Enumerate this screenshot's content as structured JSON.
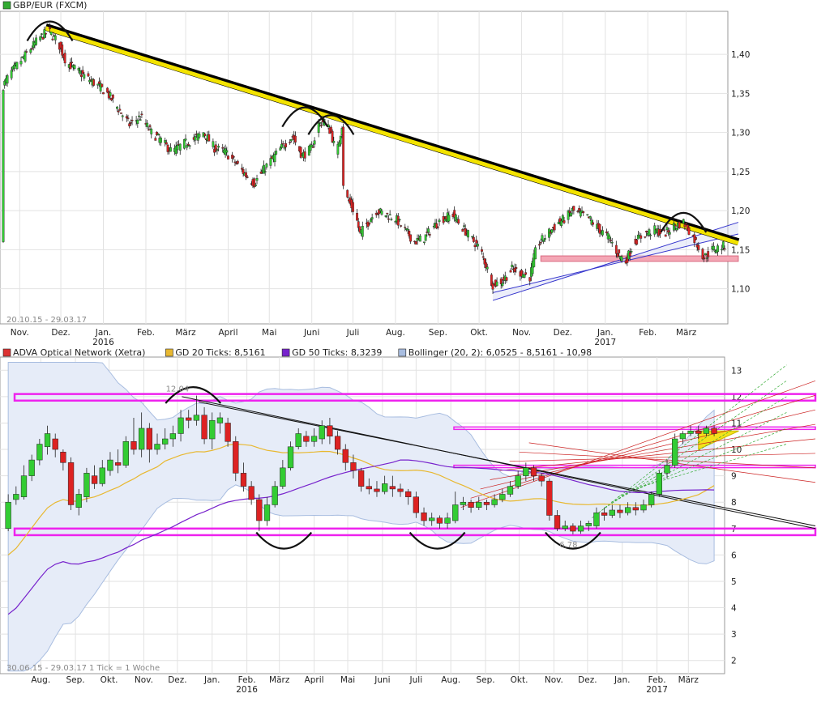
{
  "chart_data": [
    {
      "type": "candlestick",
      "legend": [
        {
          "name": "GBP/EUR (FXCM)",
          "color": "#33aa33"
        }
      ],
      "date_range_label": "20.10.15 - 29.03.17",
      "y_ticks": [
        1.1,
        1.15,
        1.2,
        1.25,
        1.3,
        1.35,
        1.4
      ],
      "y_tick_labels": [
        "1,10",
        "1,15",
        "1,20",
        "1,25",
        "1,30",
        "1,35",
        "1,40"
      ],
      "ylim": [
        1.055,
        1.455
      ],
      "x_range": [
        "2015-10-20",
        "2017-03-29"
      ],
      "x_ticks": [
        {
          "label": "Nov.",
          "date": "2015-11-01"
        },
        {
          "label": "Dez.",
          "date": "2015-12-01"
        },
        {
          "label": "Jan.",
          "date": "2016-01-01",
          "year": "2016"
        },
        {
          "label": "Feb.",
          "date": "2016-02-01"
        },
        {
          "label": "März",
          "date": "2016-03-01"
        },
        {
          "label": "April",
          "date": "2016-04-01"
        },
        {
          "label": "Mai",
          "date": "2016-05-01"
        },
        {
          "label": "Juni",
          "date": "2016-06-01"
        },
        {
          "label": "Juli",
          "date": "2016-07-01"
        },
        {
          "label": "Aug.",
          "date": "2016-08-01"
        },
        {
          "label": "Sep.",
          "date": "2016-09-01"
        },
        {
          "label": "Okt.",
          "date": "2016-10-01"
        },
        {
          "label": "Nov.",
          "date": "2016-11-01"
        },
        {
          "label": "Dez.",
          "date": "2016-12-01"
        },
        {
          "label": "Jan.",
          "date": "2017-01-01",
          "year": "2017"
        },
        {
          "label": "Feb.",
          "date": "2017-02-01"
        },
        {
          "label": "März",
          "date": "2017-03-01"
        }
      ],
      "price_path": [
        [
          "2015-10-20",
          1.36
        ],
        [
          "2015-10-25",
          1.375
        ],
        [
          "2015-11-01",
          1.39
        ],
        [
          "2015-11-08",
          1.405
        ],
        [
          "2015-11-15",
          1.42
        ],
        [
          "2015-11-22",
          1.43
        ],
        [
          "2015-11-29",
          1.415
        ],
        [
          "2015-12-05",
          1.39
        ],
        [
          "2015-12-12",
          1.38
        ],
        [
          "2015-12-20",
          1.37
        ],
        [
          "2015-12-28",
          1.36
        ],
        [
          "2016-01-04",
          1.35
        ],
        [
          "2016-01-12",
          1.33
        ],
        [
          "2016-01-20",
          1.31
        ],
        [
          "2016-01-28",
          1.32
        ],
        [
          "2016-02-05",
          1.3
        ],
        [
          "2016-02-12",
          1.29
        ],
        [
          "2016-02-20",
          1.275
        ],
        [
          "2016-02-28",
          1.285
        ],
        [
          "2016-03-06",
          1.29
        ],
        [
          "2016-03-14",
          1.3
        ],
        [
          "2016-03-22",
          1.28
        ],
        [
          "2016-03-30",
          1.275
        ],
        [
          "2016-04-07",
          1.26
        ],
        [
          "2016-04-14",
          1.245
        ],
        [
          "2016-04-20",
          1.235
        ],
        [
          "2016-04-28",
          1.255
        ],
        [
          "2016-05-05",
          1.27
        ],
        [
          "2016-05-12",
          1.285
        ],
        [
          "2016-05-18",
          1.295
        ],
        [
          "2016-05-25",
          1.27
        ],
        [
          "2016-06-01",
          1.28
        ],
        [
          "2016-06-06",
          1.31
        ],
        [
          "2016-06-10",
          1.315
        ],
        [
          "2016-06-15",
          1.3
        ],
        [
          "2016-06-19",
          1.27
        ],
        [
          "2016-06-23",
          1.31
        ],
        [
          "2016-06-24",
          1.235
        ],
        [
          "2016-06-27",
          1.215
        ],
        [
          "2016-07-03",
          1.195
        ],
        [
          "2016-07-06",
          1.17
        ],
        [
          "2016-07-12",
          1.185
        ],
        [
          "2016-07-18",
          1.2
        ],
        [
          "2016-07-25",
          1.195
        ],
        [
          "2016-08-01",
          1.19
        ],
        [
          "2016-08-08",
          1.175
        ],
        [
          "2016-08-15",
          1.16
        ],
        [
          "2016-08-22",
          1.165
        ],
        [
          "2016-08-29",
          1.18
        ],
        [
          "2016-09-05",
          1.19
        ],
        [
          "2016-09-12",
          1.195
        ],
        [
          "2016-09-18",
          1.18
        ],
        [
          "2016-09-25",
          1.165
        ],
        [
          "2016-10-02",
          1.15
        ],
        [
          "2016-10-07",
          1.125
        ],
        [
          "2016-10-11",
          1.105
        ],
        [
          "2016-10-18",
          1.11
        ],
        [
          "2016-10-25",
          1.125
        ],
        [
          "2016-11-01",
          1.12
        ],
        [
          "2016-11-07",
          1.115
        ],
        [
          "2016-11-12",
          1.155
        ],
        [
          "2016-11-20",
          1.17
        ],
        [
          "2016-11-28",
          1.185
        ],
        [
          "2016-12-03",
          1.19
        ],
        [
          "2016-12-08",
          1.2
        ],
        [
          "2016-12-15",
          1.195
        ],
        [
          "2016-12-20",
          1.19
        ],
        [
          "2016-12-28",
          1.175
        ],
        [
          "2017-01-04",
          1.165
        ],
        [
          "2017-01-10",
          1.145
        ],
        [
          "2017-01-16",
          1.135
        ],
        [
          "2017-01-22",
          1.16
        ],
        [
          "2017-01-30",
          1.17
        ],
        [
          "2017-02-06",
          1.175
        ],
        [
          "2017-02-13",
          1.17
        ],
        [
          "2017-02-20",
          1.18
        ],
        [
          "2017-02-27",
          1.185
        ],
        [
          "2017-03-03",
          1.175
        ],
        [
          "2017-03-08",
          1.16
        ],
        [
          "2017-03-14",
          1.14
        ],
        [
          "2017-03-20",
          1.15
        ],
        [
          "2017-03-29",
          1.155
        ]
      ],
      "trendlines": [
        {
          "kind": "resistance",
          "from": [
            "2015-11-20",
            1.435
          ],
          "to": [
            "2017-04-08",
            1.16
          ],
          "color": "#f3e300"
        },
        {
          "kind": "channel",
          "from": [
            "2016-10-11",
            1.085
          ],
          "to": [
            "2017-04-08",
            1.185
          ],
          "color": "#3333cc"
        },
        {
          "kind": "channel",
          "from": [
            "2016-10-11",
            1.095
          ],
          "to": [
            "2017-04-08",
            1.17
          ],
          "color": "#3333cc"
        }
      ],
      "support_zone": {
        "from_date": "2016-11-15",
        "to_date": "2017-04-08",
        "low": 1.135,
        "high": 1.142,
        "color": "#f4a7b5"
      },
      "pattern_arcs": [
        {
          "date": "2015-11-23",
          "value": 1.44
        },
        {
          "date": "2016-05-27",
          "value": 1.33
        },
        {
          "date": "2016-06-15",
          "value": 1.32
        },
        {
          "date": "2017-02-27",
          "value": 1.195
        }
      ]
    },
    {
      "type": "candlestick",
      "legend": [
        {
          "name": "ADVA Optical Network (Xetra)",
          "color": "#dd3333"
        },
        {
          "name": "GD 20 Ticks: 8,5161",
          "color": "#e8b830"
        },
        {
          "name": "GD 50 Ticks: 8,3239",
          "color": "#7722cc"
        },
        {
          "name": "Bollinger (20, 2): 6,0525 - 8,5161 - 10,98",
          "color": "#a8bde0"
        }
      ],
      "date_range_label": "30.06.15 - 29.03.17",
      "tick_note": "1 Tick = 1 Woche",
      "y_ticks": [
        2,
        3,
        4,
        5,
        6,
        7,
        8,
        9,
        10,
        11,
        12,
        13
      ],
      "y_tick_labels": [
        "2",
        "3",
        "4",
        "5",
        "6",
        "7",
        "8",
        "9",
        "10",
        "11",
        "12",
        "13"
      ],
      "ylim": [
        1.5,
        13.5
      ],
      "x_range": [
        "2015-06-30",
        "2017-03-29"
      ],
      "x_ticks": [
        {
          "label": "Aug.",
          "date": "2015-08-01"
        },
        {
          "label": "Sep.",
          "date": "2015-09-01"
        },
        {
          "label": "Okt.",
          "date": "2015-10-01"
        },
        {
          "label": "Nov.",
          "date": "2015-11-01"
        },
        {
          "label": "Dez.",
          "date": "2015-12-01"
        },
        {
          "label": "Jan.",
          "date": "2016-01-01"
        },
        {
          "label": "Feb.",
          "date": "2016-02-01",
          "year": "2016"
        },
        {
          "label": "März",
          "date": "2016-03-01"
        },
        {
          "label": "April",
          "date": "2016-04-01"
        },
        {
          "label": "Mai",
          "date": "2016-05-01"
        },
        {
          "label": "Juni",
          "date": "2016-06-01"
        },
        {
          "label": "Juli",
          "date": "2016-07-01"
        },
        {
          "label": "Aug.",
          "date": "2016-08-01"
        },
        {
          "label": "Sep.",
          "date": "2016-09-01"
        },
        {
          "label": "Okt.",
          "date": "2016-10-01"
        },
        {
          "label": "Nov.",
          "date": "2016-11-01"
        },
        {
          "label": "Dez.",
          "date": "2016-12-01"
        },
        {
          "label": "Jan.",
          "date": "2017-01-01"
        },
        {
          "label": "Feb.",
          "date": "2017-02-01",
          "year": "2017"
        },
        {
          "label": "März",
          "date": "2017-03-01"
        }
      ],
      "candles": [
        [
          7.0,
          8.0,
          6.9,
          8.3
        ],
        [
          8.1,
          8.3,
          7.9,
          8.6
        ],
        [
          8.2,
          9.0,
          8.1,
          9.4
        ],
        [
          9.0,
          9.6,
          8.8,
          9.8
        ],
        [
          9.6,
          10.2,
          9.4,
          10.4
        ],
        [
          10.1,
          10.6,
          9.8,
          10.9
        ],
        [
          10.4,
          10.0,
          9.7,
          10.6
        ],
        [
          9.9,
          9.5,
          9.2,
          10.0
        ],
        [
          9.5,
          7.9,
          7.7,
          9.7
        ],
        [
          7.8,
          8.3,
          7.5,
          8.5
        ],
        [
          8.2,
          9.1,
          8.0,
          9.3
        ],
        [
          9.0,
          8.7,
          8.5,
          9.4
        ],
        [
          8.7,
          9.3,
          8.6,
          9.6
        ],
        [
          9.2,
          9.6,
          9.0,
          9.9
        ],
        [
          9.5,
          9.4,
          9.1,
          10.0
        ],
        [
          9.4,
          10.3,
          9.3,
          10.5
        ],
        [
          10.3,
          10.0,
          9.8,
          11.2
        ],
        [
          10.0,
          10.8,
          9.7,
          11.4
        ],
        [
          10.8,
          10.0,
          9.5,
          11.0
        ],
        [
          10.0,
          10.2,
          9.8,
          10.6
        ],
        [
          10.2,
          10.4,
          10.0,
          10.8
        ],
        [
          10.4,
          10.6,
          10.1,
          10.9
        ],
        [
          10.6,
          11.2,
          10.3,
          11.5
        ],
        [
          11.2,
          11.1,
          10.8,
          11.5
        ],
        [
          11.1,
          11.3,
          10.9,
          12.04
        ],
        [
          11.3,
          10.4,
          10.2,
          11.6
        ],
        [
          10.4,
          11.1,
          10.0,
          11.4
        ],
        [
          11.0,
          11.2,
          10.6,
          11.4
        ],
        [
          11.0,
          10.3,
          10.1,
          11.2
        ],
        [
          10.3,
          9.1,
          8.8,
          10.5
        ],
        [
          9.1,
          8.6,
          8.4,
          9.5
        ],
        [
          8.6,
          8.1,
          7.9,
          8.8
        ],
        [
          8.1,
          7.3,
          6.9,
          8.3
        ],
        [
          7.3,
          7.9,
          7.1,
          8.2
        ],
        [
          7.9,
          8.6,
          7.8,
          8.8
        ],
        [
          8.6,
          9.3,
          8.5,
          9.6
        ],
        [
          9.3,
          10.1,
          9.2,
          10.3
        ],
        [
          10.1,
          10.6,
          10.0,
          10.8
        ],
        [
          10.5,
          10.3,
          10.1,
          10.7
        ],
        [
          10.3,
          10.5,
          10.1,
          10.8
        ],
        [
          10.4,
          10.9,
          10.2,
          11.1
        ],
        [
          10.9,
          10.5,
          10.2,
          11.2
        ],
        [
          10.5,
          10.0,
          9.8,
          10.7
        ],
        [
          10.0,
          9.5,
          9.2,
          10.2
        ],
        [
          9.5,
          9.2,
          8.9,
          9.8
        ],
        [
          9.2,
          8.6,
          8.4,
          9.3
        ],
        [
          8.6,
          8.5,
          8.3,
          8.9
        ],
        [
          8.5,
          8.4,
          8.2,
          8.8
        ],
        [
          8.4,
          8.7,
          8.3,
          9.0
        ],
        [
          8.6,
          8.5,
          8.2,
          9.0
        ],
        [
          8.5,
          8.4,
          8.2,
          8.7
        ],
        [
          8.4,
          8.2,
          7.9,
          8.5
        ],
        [
          8.2,
          7.6,
          7.4,
          8.4
        ],
        [
          7.6,
          7.3,
          7.1,
          7.8
        ],
        [
          7.3,
          7.4,
          7.1,
          7.6
        ],
        [
          7.4,
          7.2,
          7.0,
          7.5
        ],
        [
          7.2,
          7.4,
          7.0,
          7.6
        ],
        [
          7.3,
          7.9,
          7.2,
          8.4
        ],
        [
          7.9,
          8.0,
          7.7,
          8.2
        ],
        [
          8.0,
          7.8,
          7.6,
          8.1
        ],
        [
          7.8,
          8.0,
          7.7,
          8.2
        ],
        [
          8.0,
          7.9,
          7.7,
          8.1
        ],
        [
          7.9,
          8.1,
          7.8,
          8.3
        ],
        [
          8.1,
          8.3,
          8.0,
          8.5
        ],
        [
          8.3,
          8.6,
          8.2,
          8.8
        ],
        [
          8.6,
          9.0,
          8.5,
          9.2
        ],
        [
          9.0,
          9.3,
          8.8,
          9.5
        ],
        [
          9.3,
          9.0,
          8.8,
          9.4
        ],
        [
          9.0,
          8.8,
          8.6,
          9.1
        ],
        [
          8.8,
          7.5,
          7.3,
          8.9
        ],
        [
          7.5,
          7.0,
          6.9,
          7.7
        ],
        [
          7.0,
          7.1,
          6.9,
          7.3
        ],
        [
          7.1,
          6.9,
          6.78,
          7.2
        ],
        [
          6.9,
          7.1,
          6.8,
          7.3
        ],
        [
          7.1,
          7.2,
          6.9,
          7.3
        ],
        [
          7.1,
          7.6,
          7.0,
          7.8
        ],
        [
          7.6,
          7.5,
          7.3,
          7.8
        ],
        [
          7.5,
          7.7,
          7.4,
          7.9
        ],
        [
          7.7,
          7.6,
          7.4,
          7.9
        ],
        [
          7.6,
          7.8,
          7.5,
          8.0
        ],
        [
          7.8,
          7.7,
          7.5,
          8.0
        ],
        [
          7.7,
          7.9,
          7.6,
          8.1
        ],
        [
          7.9,
          8.3,
          7.8,
          8.4
        ],
        [
          8.3,
          9.1,
          8.2,
          9.2
        ],
        [
          9.1,
          9.4,
          8.9,
          9.6
        ],
        [
          9.4,
          10.4,
          9.3,
          10.6
        ],
        [
          10.4,
          10.6,
          10.2,
          10.7
        ],
        [
          10.6,
          10.7,
          10.5,
          10.9
        ],
        [
          10.7,
          10.6,
          10.4,
          10.9
        ],
        [
          10.6,
          10.8,
          10.5,
          10.9
        ],
        [
          10.8,
          10.6,
          10.5,
          10.9
        ]
      ],
      "annotations": [
        {
          "text": "12,04",
          "date": "2015-12-01",
          "value": 12.04
        },
        {
          "text": "6,78",
          "date": "2016-11-14",
          "value": 6.78
        }
      ],
      "horizontal_zones": [
        {
          "low": 11.85,
          "high": 12.1,
          "color": "#ee22ee"
        },
        {
          "low": 6.75,
          "high": 7.0,
          "color": "#ee22ee"
        },
        {
          "low": 10.8,
          "high": 10.85,
          "color": "#ee22ee"
        },
        {
          "low": 9.35,
          "high": 9.4,
          "color": "#ee22ee"
        }
      ],
      "yellow_zone": {
        "from_date": "2017-03-10",
        "to_date": "2017-04-15",
        "low": 10.0,
        "high": 10.7
      },
      "trendlines": [
        {
          "from": [
            "2015-12-05",
            12.0
          ],
          "to": [
            "2017-04-25",
            7.0
          ],
          "color": "#111111"
        },
        {
          "from": [
            "2015-12-20",
            11.8
          ],
          "to": [
            "2017-04-25",
            7.1
          ],
          "color": "#111111"
        }
      ]
    }
  ]
}
